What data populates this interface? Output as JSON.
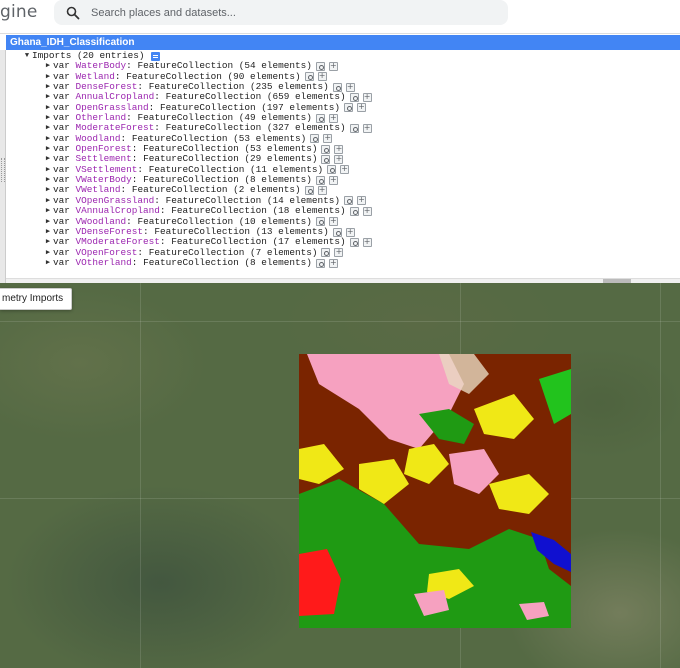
{
  "app": {
    "brand_partial": "gine",
    "search_placeholder": "Search places and datasets..."
  },
  "panel": {
    "title": "Ghana_IDH_Classification",
    "imports_header": "Imports (20 entries)",
    "keyword": "var",
    "imports": [
      {
        "name": "WaterBody",
        "type": "FeatureCollection",
        "count_text": "(54 elements)"
      },
      {
        "name": "Wetland",
        "type": "FeatureCollection",
        "count_text": "(90 elements)"
      },
      {
        "name": "DenseForest",
        "type": "FeatureCollection",
        "count_text": "(235 elements)"
      },
      {
        "name": "AnnualCropland",
        "type": "FeatureCollection",
        "count_text": "(659 elements)"
      },
      {
        "name": "OpenGrassland",
        "type": "FeatureCollection",
        "count_text": "(197 elements)"
      },
      {
        "name": "Otherland",
        "type": "FeatureCollection",
        "count_text": "(49 elements)"
      },
      {
        "name": "ModerateForest",
        "type": "FeatureCollection",
        "count_text": "(327 elements)"
      },
      {
        "name": "Woodland",
        "type": "FeatureCollection",
        "count_text": "(53 elements)"
      },
      {
        "name": "OpenForest",
        "type": "FeatureCollection",
        "count_text": "(53 elements)"
      },
      {
        "name": "Settlement",
        "type": "FeatureCollection",
        "count_text": "(29 elements)"
      },
      {
        "name": "VSettlement",
        "type": "FeatureCollection",
        "count_text": "(11 elements)"
      },
      {
        "name": "VWaterBody",
        "type": "FeatureCollection",
        "count_text": "(8 elements)"
      },
      {
        "name": "VWetland",
        "type": "FeatureCollection",
        "count_text": "(2 elements)"
      },
      {
        "name": "VOpenGrassland",
        "type": "FeatureCollection",
        "count_text": "(14 elements)"
      },
      {
        "name": "VAnnualCropland",
        "type": "FeatureCollection",
        "count_text": "(18 elements)"
      },
      {
        "name": "VWoodland",
        "type": "FeatureCollection",
        "count_text": "(10 elements)"
      },
      {
        "name": "VDenseForest",
        "type": "FeatureCollection",
        "count_text": "(13 elements)"
      },
      {
        "name": "VModerateForest",
        "type": "FeatureCollection",
        "count_text": "(17 elements)"
      },
      {
        "name": "VOpenForest",
        "type": "FeatureCollection",
        "count_text": "(7 elements)"
      },
      {
        "name": "VOtherland",
        "type": "FeatureCollection",
        "count_text": "(8 elements)"
      }
    ]
  },
  "map": {
    "geometry_button_label": "metry Imports",
    "class_colors": {
      "forest": "#1f9a13",
      "bright_forest": "#22c31d",
      "cropland": "#7a2400",
      "grassland": "#f0e816",
      "settlement": "#ff1a1a",
      "otherland": "#f6a1c0",
      "water": "#1010d0"
    }
  }
}
